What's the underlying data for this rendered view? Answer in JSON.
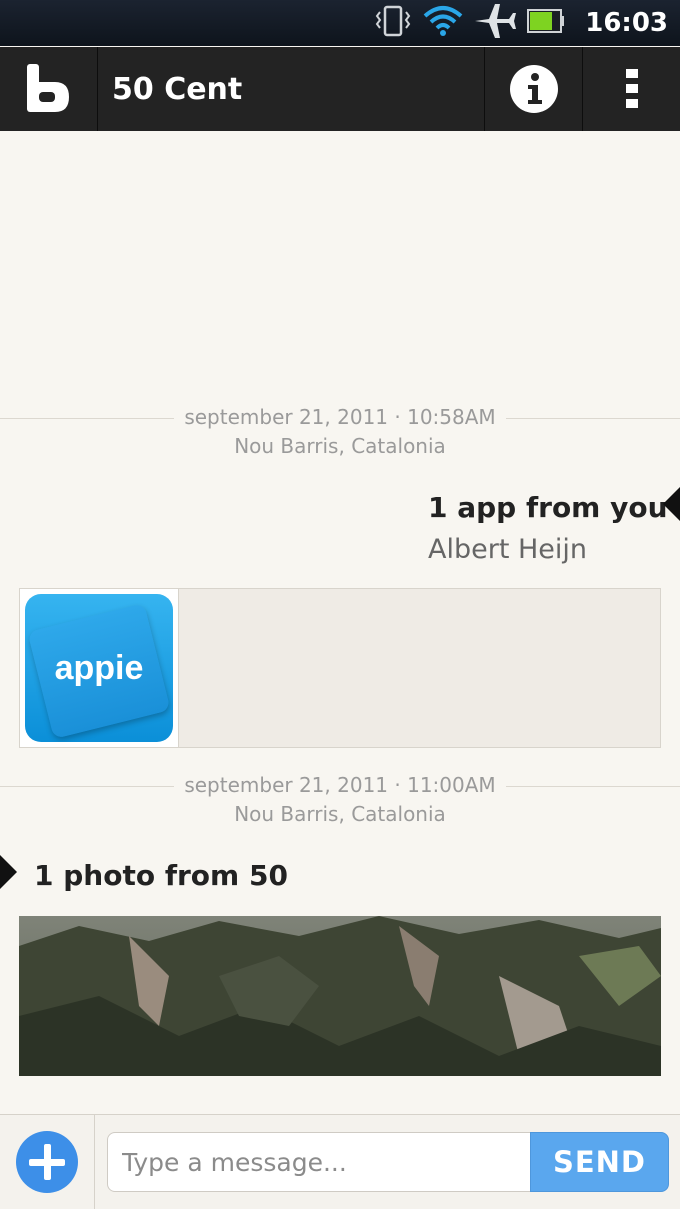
{
  "status_bar": {
    "time": "16:03",
    "icons": [
      "vibrate-icon",
      "wifi-icon",
      "airplane-icon",
      "battery-icon"
    ],
    "battery_color": "#7ed321"
  },
  "app_bar": {
    "logo": "b",
    "title": "50 Cent",
    "info_icon": "info-icon",
    "menu_icon": "overflow-menu-icon"
  },
  "conversation": {
    "messages": [
      {
        "date": "september 21, 2011 · 10:58AM",
        "location": "Nou Barris, Catalonia",
        "heading": "1 app from you",
        "subtitle": "Albert Heijn",
        "attachment_label": "appie",
        "direction": "outgoing"
      },
      {
        "date": "september 21, 2011 · 11:00AM",
        "location": "Nou Barris, Catalonia",
        "heading": "1 photo from 50",
        "direction": "incoming"
      }
    ]
  },
  "composer": {
    "placeholder": "Type a message...",
    "value": "",
    "send_label": "SEND",
    "add_icon": "plus-icon"
  },
  "colors": {
    "app_bar": "#232323",
    "background": "#f8f6f1",
    "accent": "#3d8fe8",
    "send_button": "#5aa7ee"
  }
}
